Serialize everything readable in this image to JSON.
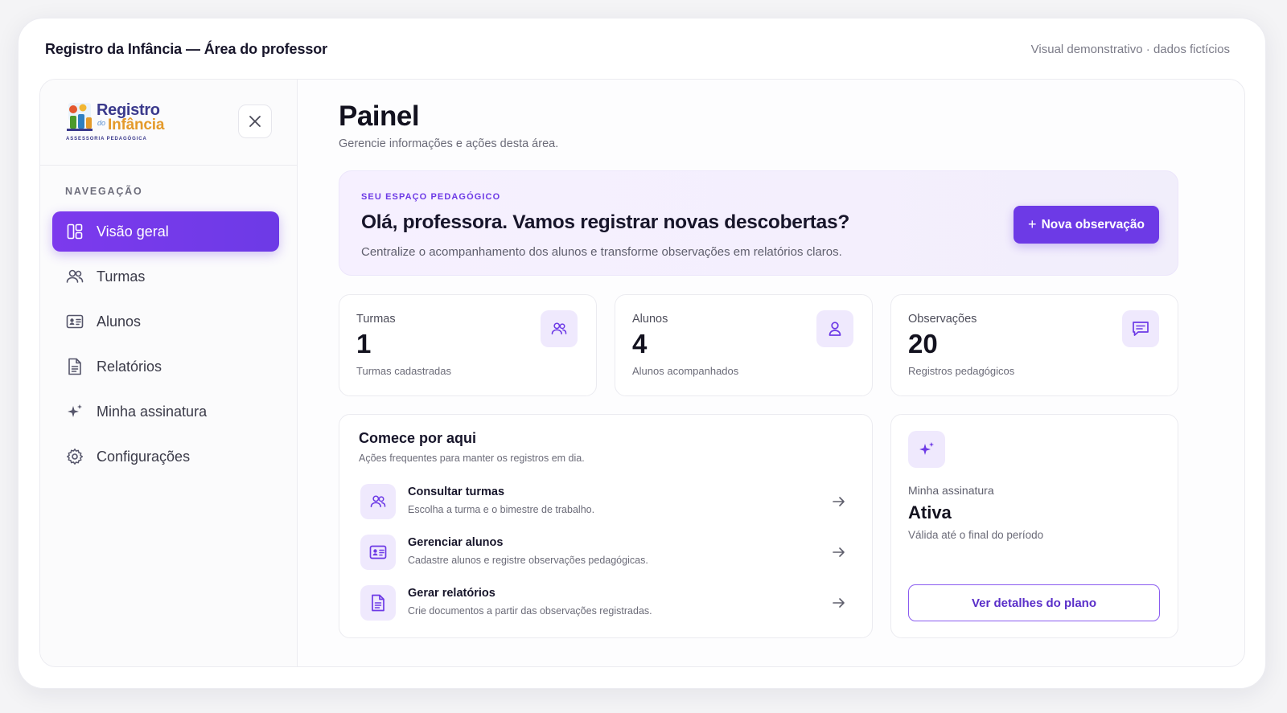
{
  "window": {
    "title": "Registro da Infância — Área do professor",
    "note": "Visual demonstrativo · dados fictícios"
  },
  "logo": {
    "line1": "Registro",
    "line2_small": "do",
    "line2": "Infância",
    "tagline": "ASSESSORIA PEDAGÓGICA"
  },
  "sidebar": {
    "section_label": "NAVEGAÇÃO",
    "items": [
      {
        "label": "Visão geral",
        "icon": "layout-icon",
        "active": true
      },
      {
        "label": "Turmas",
        "icon": "users-icon",
        "active": false
      },
      {
        "label": "Alunos",
        "icon": "id-card-icon",
        "active": false
      },
      {
        "label": "Relatórios",
        "icon": "document-icon",
        "active": false
      },
      {
        "label": "Minha assinatura",
        "icon": "sparkle-icon",
        "active": false
      },
      {
        "label": "Configurações",
        "icon": "gear-icon",
        "active": false
      }
    ]
  },
  "header": {
    "title": "Painel",
    "subtitle": "Gerencie informações e ações desta área."
  },
  "hero": {
    "eyebrow": "SEU ESPAÇO PEDAGÓGICO",
    "title": "Olá, professora. Vamos registrar novas descobertas?",
    "text": "Centralize o acompanhamento dos alunos e transforme observações em relatórios claros.",
    "button_label": "Nova observação",
    "button_icon": "plus-icon"
  },
  "stats": [
    {
      "label": "Turmas",
      "value": "1",
      "description": "Turmas cadastradas",
      "icon": "users-icon"
    },
    {
      "label": "Alunos",
      "value": "4",
      "description": "Alunos acompanhados",
      "icon": "user-icon"
    },
    {
      "label": "Observações",
      "value": "20",
      "description": "Registros pedagógicos",
      "icon": "message-icon"
    }
  ],
  "start": {
    "title": "Comece por aqui",
    "subtitle": "Ações frequentes para manter os registros em dia.",
    "actions": [
      {
        "title": "Consultar turmas",
        "description": "Escolha a turma e o bimestre de trabalho.",
        "icon": "users-icon"
      },
      {
        "title": "Gerenciar alunos",
        "description": "Cadastre alunos e registre observações pedagógicas.",
        "icon": "id-card-icon"
      },
      {
        "title": "Gerar relatórios",
        "description": "Crie documentos a partir das observações registradas.",
        "icon": "document-icon"
      }
    ]
  },
  "plan": {
    "label": "Minha assinatura",
    "status": "Ativa",
    "description": "Válida até o final do período",
    "button_label": "Ver detalhes do plano",
    "icon": "sparkle-icon"
  },
  "colors": {
    "accent": "#6d3ae6",
    "accent_soft": "#efe9fd",
    "text": "#17152a",
    "muted": "#6b6b78"
  }
}
